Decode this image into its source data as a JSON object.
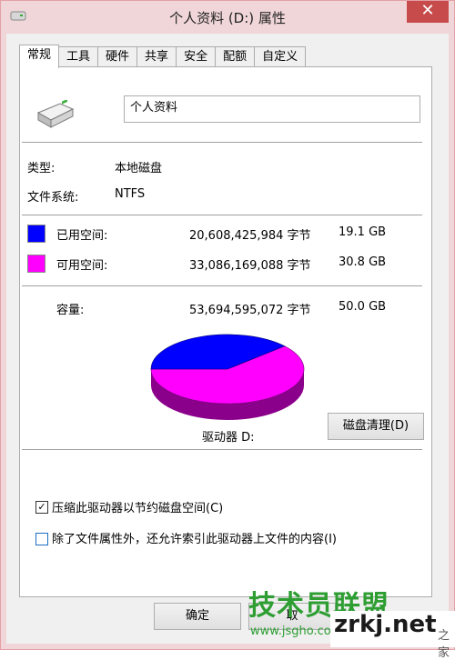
{
  "window": {
    "title": "个人资料 (D:) 属性",
    "close_symbol": "✕"
  },
  "tabs": [
    "常规",
    "工具",
    "硬件",
    "共享",
    "安全",
    "配额",
    "自定义"
  ],
  "general": {
    "drive_name": "个人资料",
    "type_label": "类型:",
    "type_value": "本地磁盘",
    "fs_label": "文件系统:",
    "fs_value": "NTFS",
    "used": {
      "label": "已用空间:",
      "bytes": "20,608,425,984 字节",
      "size": "19.1 GB",
      "color": "#0000ff"
    },
    "free": {
      "label": "可用空间:",
      "bytes": "33,086,169,088 字节",
      "size": "30.8 GB",
      "color": "#ff00ff"
    },
    "capacity": {
      "label": "容量:",
      "bytes": "53,694,595,072 字节",
      "size": "50.0 GB"
    },
    "pie": {
      "used_fraction": 0.384,
      "used_color": "#0000ff",
      "free_color": "#ff00ff"
    },
    "drive_label": "驱动器 D:",
    "cleanup_button": "磁盘清理(D)",
    "compress_checkbox": {
      "label": "压缩此驱动器以节约磁盘空间(C)",
      "checked": true
    },
    "index_checkbox": {
      "label": "除了文件属性外，还允许索引此驱动器上文件的内容(I)",
      "checked": false
    }
  },
  "buttons": {
    "ok": "确定",
    "cancel": "取"
  },
  "watermark": {
    "main": "技术员联盟",
    "url": "www.jsgho.com",
    "site": "zrkj.net",
    "suffix": "之家"
  }
}
